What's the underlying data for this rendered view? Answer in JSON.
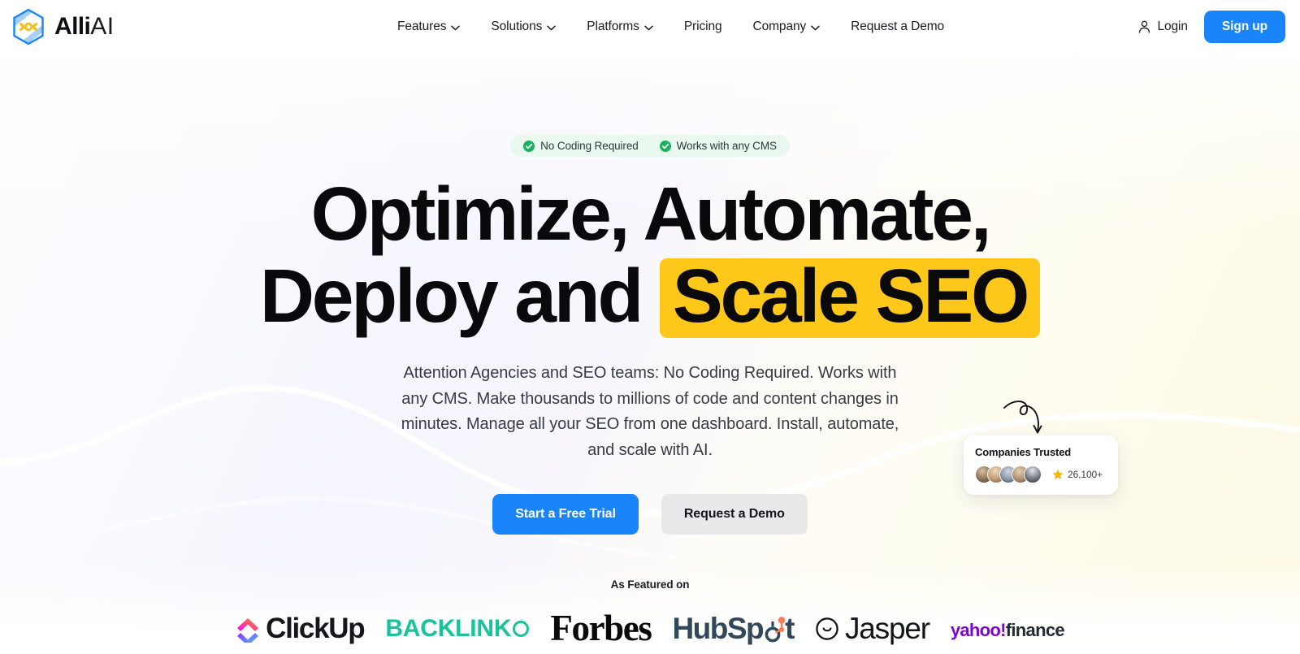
{
  "brand": {
    "name_bold": "Alli",
    "name_light": "AI",
    "logo_icon": "alli-hexagon-logo"
  },
  "header": {
    "nav": [
      {
        "label": "Features",
        "has_dropdown": true,
        "icon": "chevron-down-icon"
      },
      {
        "label": "Solutions",
        "has_dropdown": true,
        "icon": "chevron-down-icon"
      },
      {
        "label": "Platforms",
        "has_dropdown": true,
        "icon": "chevron-down-icon"
      },
      {
        "label": "Pricing",
        "has_dropdown": false,
        "icon": ""
      },
      {
        "label": "Company",
        "has_dropdown": true,
        "icon": "chevron-down-icon"
      },
      {
        "label": "Request a Demo",
        "has_dropdown": false,
        "icon": ""
      }
    ],
    "login_label": "Login",
    "login_icon": "user-icon",
    "signup_label": "Sign up"
  },
  "hero": {
    "badges": [
      {
        "label": "No Coding Required",
        "icon": "check-circle-icon"
      },
      {
        "label": "Works with any CMS",
        "icon": "check-circle-icon"
      }
    ],
    "headline_line1": "Optimize, Automate,",
    "headline_line2_prefix": "Deploy and ",
    "headline_highlight": "Scale SEO",
    "subtext": "Attention Agencies and SEO teams: No Coding Required. Works with any CMS. Make thousands to millions of code and content changes in minutes. Manage all your SEO from one dashboard. Install, automate, and scale with AI.",
    "cta_primary": "Start a Free Trial",
    "cta_secondary": "Request a Demo"
  },
  "trust_card": {
    "title": "Companies Trusted",
    "count": "26,100+",
    "star_icon": "star-icon",
    "avatar_count": 5,
    "arrow_icon": "curved-arrow-down-icon"
  },
  "featured": {
    "label": "As Featured on",
    "logos": [
      {
        "name": "ClickUp",
        "text": "ClickUp",
        "icon": "clickup-chevron-icon"
      },
      {
        "name": "Backlinko",
        "text": "BACKLINK",
        "icon": "backlinko-o-icon"
      },
      {
        "name": "Forbes",
        "text": "Forbes",
        "icon": ""
      },
      {
        "name": "HubSpot",
        "text": "HubSp",
        "icon": "hubspot-sprocket-icon"
      },
      {
        "name": "Jasper",
        "text": "Jasper",
        "icon": "jasper-smile-icon"
      },
      {
        "name": "Yahoo Finance",
        "text_a": "yahoo!",
        "text_b": "finance",
        "icon": ""
      }
    ]
  },
  "colors": {
    "accent_blue": "#1a85fb",
    "highlight_yellow": "#fdc81a",
    "badge_green": "#19b05f",
    "badge_bg": "#e9f9ef",
    "text_dark": "#0a0a0c"
  }
}
